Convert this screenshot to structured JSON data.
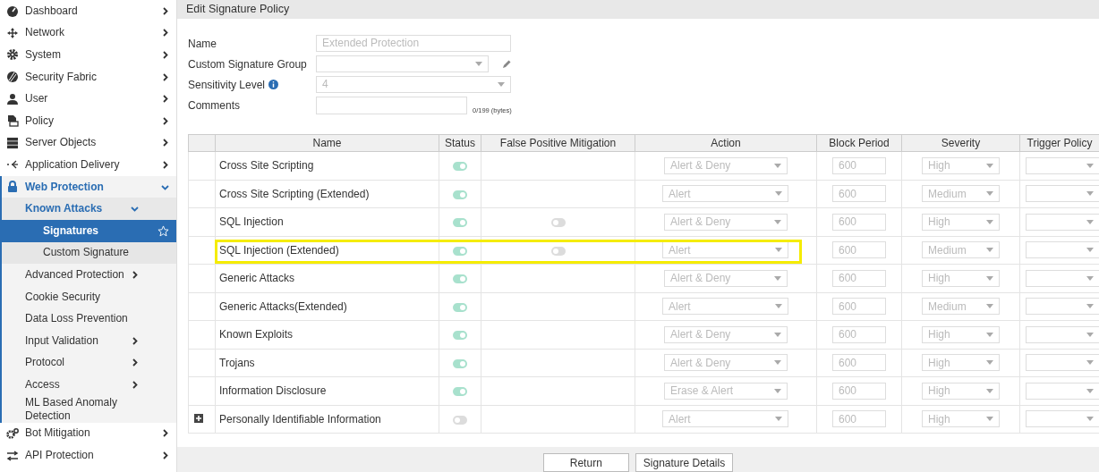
{
  "sidebar": {
    "items": [
      {
        "label": "Dashboard",
        "collapsible": true,
        "expanded": false,
        "selected": false
      },
      {
        "label": "Network",
        "collapsible": true,
        "expanded": false,
        "selected": false
      },
      {
        "label": "System",
        "collapsible": true,
        "expanded": false,
        "selected": false
      },
      {
        "label": "Security Fabric",
        "collapsible": true,
        "expanded": false,
        "selected": false
      },
      {
        "label": "User",
        "collapsible": true,
        "expanded": false,
        "selected": false
      },
      {
        "label": "Policy",
        "collapsible": true,
        "expanded": false,
        "selected": false
      },
      {
        "label": "Server Objects",
        "collapsible": true,
        "expanded": false,
        "selected": false
      },
      {
        "label": "Application Delivery",
        "collapsible": true,
        "expanded": false,
        "selected": false
      },
      {
        "label": "Web Protection",
        "collapsible": true,
        "expanded": true,
        "selected": false,
        "children": [
          {
            "label": "Known Attacks",
            "collapsible": true,
            "expanded": true,
            "selected": false,
            "children": [
              {
                "label": "Signatures",
                "collapsible": false,
                "expanded": false,
                "selected": true
              },
              {
                "label": "Custom Signature",
                "collapsible": false,
                "expanded": false,
                "selected": false
              }
            ]
          },
          {
            "label": "Advanced Protection",
            "collapsible": true,
            "expanded": false,
            "selected": false
          },
          {
            "label": "Cookie Security",
            "collapsible": false,
            "expanded": false,
            "selected": false
          },
          {
            "label": "Data Loss Prevention",
            "collapsible": false,
            "expanded": false,
            "selected": false
          },
          {
            "label": "Input Validation",
            "collapsible": true,
            "expanded": false,
            "selected": false
          },
          {
            "label": "Protocol",
            "collapsible": true,
            "expanded": false,
            "selected": false
          },
          {
            "label": "Access",
            "collapsible": true,
            "expanded": false,
            "selected": false
          },
          {
            "label": "ML Based Anomaly Detection",
            "collapsible": false,
            "expanded": false,
            "selected": false
          }
        ]
      },
      {
        "label": "Bot Mitigation",
        "collapsible": true,
        "expanded": false,
        "selected": false
      },
      {
        "label": "API Protection",
        "collapsible": true,
        "expanded": false,
        "selected": false
      }
    ]
  },
  "page_title": "Edit Signature Policy",
  "form": {
    "name": {
      "label": "Name",
      "value": "Extended Protection"
    },
    "custom_signature_group": {
      "label": "Custom Signature Group"
    },
    "sensitivity_level": {
      "label": "Sensitivity Level",
      "value": "4"
    },
    "comments": {
      "label": "Comments",
      "counter": "0/199 (bytes)"
    }
  },
  "table": {
    "columns": [
      "Name",
      "Status",
      "False Positive Mitigation",
      "Action",
      "Block Period",
      "Severity",
      "Trigger Policy"
    ],
    "rows": [
      {
        "name": "Cross Site Scripting",
        "status": true,
        "false_positive_mitigation": null,
        "action": "Alert & Deny",
        "block_period": "600",
        "severity": "High",
        "expandable": false,
        "highlighted": false
      },
      {
        "name": "Cross Site Scripting (Extended)",
        "status": true,
        "false_positive_mitigation": null,
        "action": "Alert",
        "block_period": "600",
        "severity": "Medium",
        "expandable": false,
        "highlighted": false
      },
      {
        "name": "SQL Injection",
        "status": true,
        "false_positive_mitigation": false,
        "action": "Alert & Deny",
        "block_period": "600",
        "severity": "High",
        "expandable": false,
        "highlighted": false
      },
      {
        "name": "SQL Injection (Extended)",
        "status": true,
        "false_positive_mitigation": false,
        "action": "Alert",
        "block_period": "600",
        "severity": "Medium",
        "expandable": false,
        "highlighted": true
      },
      {
        "name": "Generic Attacks",
        "status": true,
        "false_positive_mitigation": null,
        "action": "Alert & Deny",
        "block_period": "600",
        "severity": "High",
        "expandable": false,
        "highlighted": false
      },
      {
        "name": "Generic Attacks(Extended)",
        "status": true,
        "false_positive_mitigation": null,
        "action": "Alert",
        "block_period": "600",
        "severity": "Medium",
        "expandable": false,
        "highlighted": false
      },
      {
        "name": "Known Exploits",
        "status": true,
        "false_positive_mitigation": null,
        "action": "Alert & Deny",
        "block_period": "600",
        "severity": "High",
        "expandable": false,
        "highlighted": false
      },
      {
        "name": "Trojans",
        "status": true,
        "false_positive_mitigation": null,
        "action": "Alert & Deny",
        "block_period": "600",
        "severity": "High",
        "expandable": false,
        "highlighted": false
      },
      {
        "name": "Information Disclosure",
        "status": true,
        "false_positive_mitigation": null,
        "action": "Erase & Alert",
        "block_period": "600",
        "severity": "High",
        "expandable": false,
        "highlighted": false
      },
      {
        "name": "Personally Identifiable Information",
        "status": false,
        "false_positive_mitigation": null,
        "action": "Alert",
        "block_period": "600",
        "severity": "High",
        "expandable": true,
        "highlighted": false
      }
    ]
  },
  "buttons": [
    "Return",
    "Signature Details"
  ]
}
